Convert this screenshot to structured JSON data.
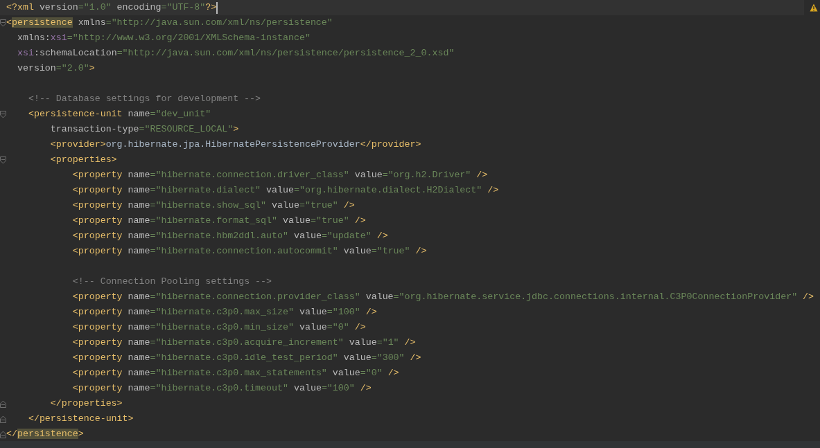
{
  "warning_indicator": true,
  "lines": [
    {
      "kind": "code",
      "cursor": true,
      "tokens": [
        {
          "kind": "tag",
          "text": "<?xml"
        },
        {
          "kind": "attr",
          "text": " version"
        },
        {
          "kind": "val",
          "text": "=\"1.0\""
        },
        {
          "kind": "attr",
          "text": " encoding"
        },
        {
          "kind": "val",
          "text": "=\"UTF-8\""
        },
        {
          "kind": "tag",
          "text": "?>"
        }
      ]
    },
    {
      "kind": "code",
      "expanded": true,
      "tokens": [
        {
          "kind": "tag",
          "text": "<"
        },
        {
          "kind": "match",
          "text": "persistence"
        },
        {
          "kind": "attr",
          "text": " xmlns"
        },
        {
          "kind": "val",
          "text": "=\"http://java.sun.com/xml/ns/persistence\""
        }
      ],
      "continuation": [
        {
          "tokens": [
            {
              "kind": "attr",
              "text": "xmlns:"
            },
            {
              "kind": "ns",
              "text": "xsi"
            },
            {
              "kind": "val",
              "text": "=\"http://www.w3.org/2001/XMLSchema-instance\""
            }
          ]
        },
        {
          "tokens": [
            {
              "kind": "ns",
              "text": "xsi"
            },
            {
              "kind": "attr",
              "text": ":schemaLocation"
            },
            {
              "kind": "val",
              "text": "=\"http://java.sun.com/xml/ns/persistence/persistence_2_0.xsd\""
            }
          ]
        },
        {
          "tokens": [
            {
              "kind": "attr",
              "text": "version"
            },
            {
              "kind": "val",
              "text": "=\"2.0\""
            },
            {
              "kind": "tag",
              "text": ">"
            }
          ]
        }
      ],
      "children": [
        {
          "kind": "blank"
        },
        {
          "kind": "code",
          "tokens": [
            {
              "kind": "comment",
              "text": "<!-- Database settings for development -->"
            }
          ]
        },
        {
          "kind": "code",
          "expanded": true,
          "tokens": [
            {
              "kind": "tag",
              "text": "<persistence-unit"
            },
            {
              "kind": "attr",
              "text": " name"
            },
            {
              "kind": "val",
              "text": "=\"dev_unit\""
            }
          ],
          "continuation": [
            {
              "tokens": [
                {
                  "kind": "attr",
                  "text": "transaction-type"
                },
                {
                  "kind": "val",
                  "text": "=\"RESOURCE_LOCAL\""
                },
                {
                  "kind": "tag",
                  "text": ">"
                }
              ]
            }
          ],
          "children": [
            {
              "kind": "code",
              "tokens": [
                {
                  "kind": "tag",
                  "text": "<provider>"
                },
                {
                  "kind": "text",
                  "text": "org.hibernate.jpa.HibernatePersistenceProvider"
                },
                {
                  "kind": "tag",
                  "text": "</provider>"
                }
              ]
            },
            {
              "kind": "code",
              "expanded": true,
              "tokens": [
                {
                  "kind": "tag",
                  "text": "<properties>"
                }
              ],
              "children": [
                {
                  "kind": "code",
                  "tokens": [
                    {
                      "kind": "tag",
                      "text": "<property"
                    },
                    {
                      "kind": "attr",
                      "text": " name"
                    },
                    {
                      "kind": "val",
                      "text": "=\"hibernate.connection.driver_class\""
                    },
                    {
                      "kind": "attr",
                      "text": " value"
                    },
                    {
                      "kind": "val",
                      "text": "=\"org.h2.Driver\""
                    },
                    {
                      "kind": "tag",
                      "text": " />"
                    }
                  ]
                },
                {
                  "kind": "code",
                  "tokens": [
                    {
                      "kind": "tag",
                      "text": "<property"
                    },
                    {
                      "kind": "attr",
                      "text": " name"
                    },
                    {
                      "kind": "val",
                      "text": "=\"hibernate.dialect\""
                    },
                    {
                      "kind": "attr",
                      "text": " value"
                    },
                    {
                      "kind": "val",
                      "text": "=\"org.hibernate.dialect.H2Dialect\""
                    },
                    {
                      "kind": "tag",
                      "text": " />"
                    }
                  ]
                },
                {
                  "kind": "code",
                  "tokens": [
                    {
                      "kind": "tag",
                      "text": "<property"
                    },
                    {
                      "kind": "attr",
                      "text": " name"
                    },
                    {
                      "kind": "val",
                      "text": "=\"hibernate.show_sql\""
                    },
                    {
                      "kind": "attr",
                      "text": " value"
                    },
                    {
                      "kind": "val",
                      "text": "=\"true\""
                    },
                    {
                      "kind": "tag",
                      "text": " />"
                    }
                  ]
                },
                {
                  "kind": "code",
                  "tokens": [
                    {
                      "kind": "tag",
                      "text": "<property"
                    },
                    {
                      "kind": "attr",
                      "text": " name"
                    },
                    {
                      "kind": "val",
                      "text": "=\"hibernate.format_sql\""
                    },
                    {
                      "kind": "attr",
                      "text": " value"
                    },
                    {
                      "kind": "val",
                      "text": "=\"true\""
                    },
                    {
                      "kind": "tag",
                      "text": " />"
                    }
                  ]
                },
                {
                  "kind": "code",
                  "tokens": [
                    {
                      "kind": "tag",
                      "text": "<property"
                    },
                    {
                      "kind": "attr",
                      "text": " name"
                    },
                    {
                      "kind": "val",
                      "text": "=\"hibernate.hbm2ddl.auto\""
                    },
                    {
                      "kind": "attr",
                      "text": " value"
                    },
                    {
                      "kind": "val",
                      "text": "=\"update\""
                    },
                    {
                      "kind": "tag",
                      "text": " />"
                    }
                  ]
                },
                {
                  "kind": "code",
                  "tokens": [
                    {
                      "kind": "tag",
                      "text": "<property"
                    },
                    {
                      "kind": "attr",
                      "text": " name"
                    },
                    {
                      "kind": "val",
                      "text": "=\"hibernate.connection.autocommit\""
                    },
                    {
                      "kind": "attr",
                      "text": " value"
                    },
                    {
                      "kind": "val",
                      "text": "=\"true\""
                    },
                    {
                      "kind": "tag",
                      "text": " />"
                    }
                  ]
                },
                {
                  "kind": "blank"
                },
                {
                  "kind": "code",
                  "tokens": [
                    {
                      "kind": "comment",
                      "text": "<!-- Connection Pooling settings -->"
                    }
                  ]
                },
                {
                  "kind": "code",
                  "tokens": [
                    {
                      "kind": "tag",
                      "text": "<property"
                    },
                    {
                      "kind": "attr",
                      "text": " name"
                    },
                    {
                      "kind": "val",
                      "text": "=\"hibernate.connection.provider_class\""
                    },
                    {
                      "kind": "attr",
                      "text": " value"
                    },
                    {
                      "kind": "val",
                      "text": "=\"org.hibernate.service.jdbc.connections.internal.C3P0ConnectionProvider\""
                    },
                    {
                      "kind": "tag",
                      "text": " />"
                    }
                  ]
                },
                {
                  "kind": "code",
                  "tokens": [
                    {
                      "kind": "tag",
                      "text": "<property"
                    },
                    {
                      "kind": "attr",
                      "text": " name"
                    },
                    {
                      "kind": "val",
                      "text": "=\"hibernate.c3p0.max_size\""
                    },
                    {
                      "kind": "attr",
                      "text": " value"
                    },
                    {
                      "kind": "val",
                      "text": "=\"100\""
                    },
                    {
                      "kind": "tag",
                      "text": " />"
                    }
                  ]
                },
                {
                  "kind": "code",
                  "tokens": [
                    {
                      "kind": "tag",
                      "text": "<property"
                    },
                    {
                      "kind": "attr",
                      "text": " name"
                    },
                    {
                      "kind": "val",
                      "text": "=\"hibernate.c3p0.min_size\""
                    },
                    {
                      "kind": "attr",
                      "text": " value"
                    },
                    {
                      "kind": "val",
                      "text": "=\"0\""
                    },
                    {
                      "kind": "tag",
                      "text": " />"
                    }
                  ]
                },
                {
                  "kind": "code",
                  "tokens": [
                    {
                      "kind": "tag",
                      "text": "<property"
                    },
                    {
                      "kind": "attr",
                      "text": " name"
                    },
                    {
                      "kind": "val",
                      "text": "=\"hibernate.c3p0.acquire_increment\""
                    },
                    {
                      "kind": "attr",
                      "text": " value"
                    },
                    {
                      "kind": "val",
                      "text": "=\"1\""
                    },
                    {
                      "kind": "tag",
                      "text": " />"
                    }
                  ]
                },
                {
                  "kind": "code",
                  "tokens": [
                    {
                      "kind": "tag",
                      "text": "<property"
                    },
                    {
                      "kind": "attr",
                      "text": " name"
                    },
                    {
                      "kind": "val",
                      "text": "=\"hibernate.c3p0.idle_test_period\""
                    },
                    {
                      "kind": "attr",
                      "text": " value"
                    },
                    {
                      "kind": "val",
                      "text": "=\"300\""
                    },
                    {
                      "kind": "tag",
                      "text": " />"
                    }
                  ]
                },
                {
                  "kind": "code",
                  "tokens": [
                    {
                      "kind": "tag",
                      "text": "<property"
                    },
                    {
                      "kind": "attr",
                      "text": " name"
                    },
                    {
                      "kind": "val",
                      "text": "=\"hibernate.c3p0.max_statements\""
                    },
                    {
                      "kind": "attr",
                      "text": " value"
                    },
                    {
                      "kind": "val",
                      "text": "=\"0\""
                    },
                    {
                      "kind": "tag",
                      "text": " />"
                    }
                  ]
                },
                {
                  "kind": "code",
                  "tokens": [
                    {
                      "kind": "tag",
                      "text": "<property"
                    },
                    {
                      "kind": "attr",
                      "text": " name"
                    },
                    {
                      "kind": "val",
                      "text": "=\"hibernate.c3p0.timeout\""
                    },
                    {
                      "kind": "attr",
                      "text": " value"
                    },
                    {
                      "kind": "val",
                      "text": "=\"100\""
                    },
                    {
                      "kind": "tag",
                      "text": " />"
                    }
                  ]
                }
              ],
              "end": {
                "tokens": [
                  {
                    "kind": "tag",
                    "text": "</properties>"
                  }
                ]
              }
            }
          ],
          "end": {
            "tokens": [
              {
                "kind": "tag",
                "text": "</persistence-unit>"
              }
            ]
          }
        }
      ],
      "end": {
        "tokens": [
          {
            "kind": "tag",
            "text": "</"
          },
          {
            "kind": "match",
            "text": "persistence"
          },
          {
            "kind": "tag",
            "text": ">"
          }
        ]
      }
    }
  ]
}
